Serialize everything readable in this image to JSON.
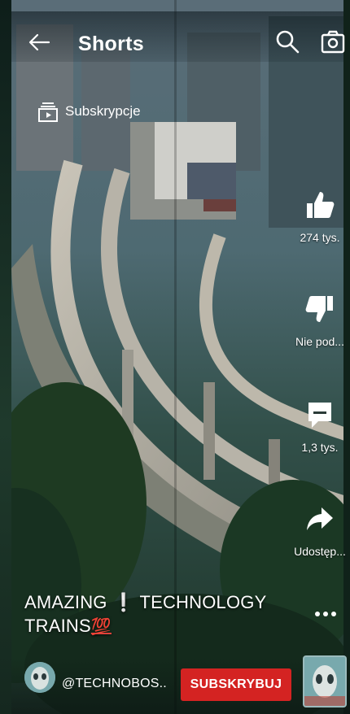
{
  "header": {
    "title": "Shorts",
    "back_icon": "arrow-left-icon",
    "search_icon": "search-icon",
    "camera_icon": "camera-icon"
  },
  "subscriptions": {
    "label": "Subskrypcje",
    "icon": "subscriptions-icon"
  },
  "actions": {
    "like": {
      "icon": "thumbs-up-icon",
      "label": "274 tys."
    },
    "dislike": {
      "icon": "thumbs-down-icon",
      "label": "Nie pod..."
    },
    "comments": {
      "icon": "comment-icon",
      "label": "1,3 tys."
    },
    "share": {
      "icon": "share-icon",
      "label": "Udostęp..."
    },
    "more": {
      "icon": "more-dots-icon"
    }
  },
  "video": {
    "caption_line1_a": "AMAZING",
    "caption_excl": "❕",
    "caption_line1_b": "TECHNOLOGY",
    "caption_line2": "TRAINS",
    "caption_emoji": "💯"
  },
  "channel": {
    "handle": "@TECHNOBOS..",
    "subscribe_label": "SUBSKRYBUJ"
  },
  "colors": {
    "subscribe": "#d42322",
    "accent_blue": "#3fa4ff"
  }
}
